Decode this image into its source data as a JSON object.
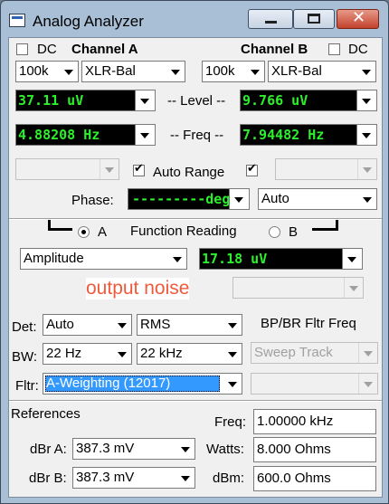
{
  "window": {
    "title": "Analog Analyzer"
  },
  "channel_a": {
    "dc_label": "DC",
    "title": "Channel A",
    "range": "100k",
    "input": "XLR-Bal",
    "level": "37.11  uV",
    "freq": "4.88208  Hz"
  },
  "channel_b": {
    "dc_label": "DC",
    "title": "Channel B",
    "range": "100k",
    "input": "XLR-Bal",
    "level": "9.766  uV",
    "freq": "7.94482  Hz"
  },
  "labels": {
    "level": "-- Level --",
    "freq": "-- Freq --",
    "auto_range": "Auto Range",
    "phase": "Phase:"
  },
  "phase": {
    "value": "---------deg",
    "mode": "Auto"
  },
  "function_reading": {
    "label": "Function Reading",
    "radio_a": "A",
    "radio_b": "B",
    "function": "Amplitude",
    "value": "17.18  uV",
    "note": "output noise"
  },
  "filters": {
    "det_label": "Det:",
    "det_mode": "Auto",
    "det_type": "RMS",
    "bw_label": "BW:",
    "bw_low": "22 Hz",
    "bw_high": "22 kHz",
    "fltr_label": "Fltr:",
    "fltr_value": "A-Weighting  (12017)",
    "bpbr_label": "BP/BR Fltr Freq",
    "sweep_track": "Sweep Track"
  },
  "references": {
    "title": "References",
    "dbra_label": "dBr A:",
    "dbra_value": "387.3   mV",
    "dbrb_label": "dBr B:",
    "dbrb_value": "387.3   mV",
    "freq_label": "Freq:",
    "freq_value": "1.00000 kHz",
    "watts_label": "Watts:",
    "watts_value": "8.000    Ohms",
    "dbm_label": "dBm:",
    "dbm_value": "600.0    Ohms"
  },
  "colors": {
    "display_text": "#2cf02c",
    "selected": "#3399ff",
    "note_text": "#f05a3c"
  }
}
